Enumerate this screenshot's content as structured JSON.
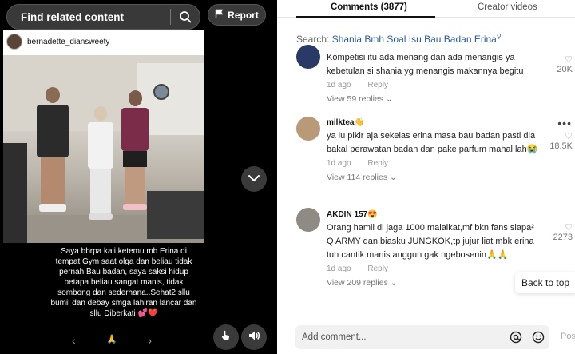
{
  "video": {
    "search_label": "Find related content",
    "report_label": "Report",
    "post_username": "bernadette_diansweety",
    "caption": "Saya bbrpa kali ketemu mb Erina di tempat Gym saat olga dan beliau tidak pernah Bau badan, saya saksi hidup betapa beliau sangat manis, tidak sombong dan sederhana..Sehat2 sllu bumil dan debay smga lahiran lancar dan sllu Diberkati 💕❤️",
    "nav_prev": "‹",
    "nav_middle": "🙏",
    "nav_next": "›"
  },
  "comments_panel": {
    "tabs": [
      {
        "label": "Comments (3877)",
        "active": true
      },
      {
        "label": "Creator videos",
        "active": false
      }
    ],
    "search_prefix": "Search:",
    "search_query": "Shania Bmh Soal Isu Bau Badan Erina",
    "comments": [
      {
        "username": "",
        "text": "Kompetisi itu ada menang dan ada menangis ya kebetulan si shania yg menangis makannya begitu",
        "time": "1d ago",
        "reply": "Reply",
        "replies": "View 59 replies",
        "likes": "20K",
        "avatar_color": "#2a3a66"
      },
      {
        "username": "milktea👋",
        "text": "ya lu pikir aja sekelas erina masa bau badan pasti dia bakal perawatan badan dan pake parfum mahal lah😭",
        "time": "1d ago",
        "reply": "Reply",
        "replies": "View 114 replies",
        "likes": "18.5K",
        "avatar_color": "#b89a78"
      },
      {
        "username": "AKDIN 157😍",
        "text": "Orang hamil di jaga 1000 malaikat,mf bkn fans siapa² Q ARMY dan biasku JUNGKOK,tp jujur liat mbk erina tuh cantik manis anggun gak ngebosenin🙏🙏",
        "time": "1d ago",
        "reply": "Reply",
        "replies": "View 209 replies",
        "likes": "2273",
        "avatar_color": "#8f8a84"
      }
    ],
    "back_to_top": "Back to top",
    "add_comment_placeholder": "Add comment...",
    "post_label": "Post"
  }
}
